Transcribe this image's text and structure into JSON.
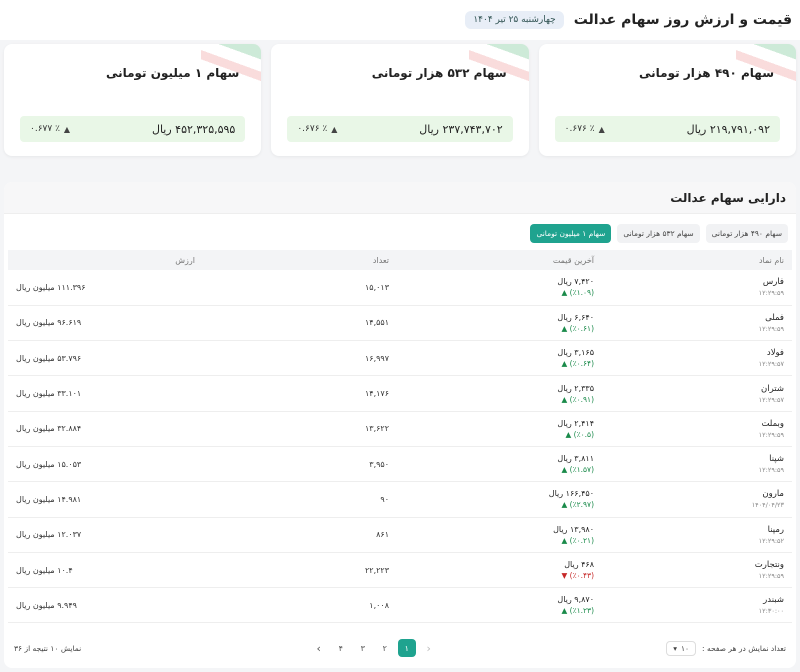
{
  "header": {
    "title": "قیمت و ارزش روز سهام عدالت",
    "date": "چهارشنبه ۲۵ تیر ۱۴۰۴"
  },
  "cards": [
    {
      "title": "سهام ۴۹۰ هزار تومانی",
      "price": "۲۱۹,۷۹۱,۰۹۲ ریال",
      "change": "٪ ۰.۶۷۶"
    },
    {
      "title": "سهام ۵۳۲ هزار تومانی",
      "price": "۲۳۷,۷۴۳,۷۰۲ ریال",
      "change": "٪ ۰.۶۷۶"
    },
    {
      "title": "سهام ۱ میلیون تومانی",
      "price": "۴۵۲,۳۲۵,۵۹۵ ریال",
      "change": "٪ ۰.۶۷۷"
    }
  ],
  "section": {
    "title": "دارایی سهام عدالت",
    "tabs": [
      "سهام ۴۹۰ هزار تومانی",
      "سهام ۵۳۲ هزار تومانی",
      "سهام ۱ میلیون تومانی"
    ],
    "active_tab": 2
  },
  "table": {
    "headers": [
      "نام نماد",
      "آخرین قیمت",
      "تعداد",
      "ارزش"
    ],
    "rows": [
      {
        "name": "فارس",
        "time": "۱۲:۲۹:۵۹",
        "price": "۷,۴۲۰ ریال",
        "change": "(٪۱.۰۹) ▲",
        "direction": "up",
        "count": "۱۵,۰۱۳",
        "value": "۱۱۱.۳۹۶ میلیون ریال"
      },
      {
        "name": "فملی",
        "time": "۱۲:۲۹:۵۹",
        "price": "۶,۶۴۰ ریال",
        "change": "(٪۰.۶۱) ▲",
        "direction": "up",
        "count": "۱۴,۵۵۱",
        "value": "۹۶.۶۱۹ میلیون ریال"
      },
      {
        "name": "فولاد",
        "time": "۱۲:۲۹:۵۷",
        "price": "۳,۱۶۵ ریال",
        "change": "(٪۰.۶۴) ▲",
        "direction": "up",
        "count": "۱۶,۹۹۷",
        "value": "۵۳.۷۹۶ میلیون ریال"
      },
      {
        "name": "شتران",
        "time": "۱۲:۲۹:۵۷",
        "price": "۲,۳۳۵ ریال",
        "change": "(٪۰.۹۱) ▲",
        "direction": "up",
        "count": "۱۴,۱۷۶",
        "value": "۳۳.۱۰۱ میلیون ریال"
      },
      {
        "name": "وبملت",
        "time": "۱۲:۲۹:۵۹",
        "price": "۲,۴۱۴ ریال",
        "change": "(٪۰.۵) ▲",
        "direction": "up",
        "count": "۱۳,۶۲۲",
        "value": "۳۲.۸۸۴ میلیون ریال"
      },
      {
        "name": "شپنا",
        "time": "۱۲:۲۹:۵۹",
        "price": "۳,۸۱۱ ریال",
        "change": "(٪۱.۵۷) ▲",
        "direction": "up",
        "count": "۳,۹۵۰",
        "value": "۱۵.۰۵۳ میلیون ریال"
      },
      {
        "name": "مارون",
        "time": "۱۴۰۴/۰۴/۲۳",
        "price": "۱۶۶,۴۵۰ ریال",
        "change": "(٪۲.۹۷) ▲",
        "direction": "up",
        "count": "۹۰",
        "value": "۱۴.۹۸۱ میلیون ریال"
      },
      {
        "name": "رمپنا",
        "time": "۱۲:۲۹:۵۲",
        "price": "۱۳,۹۸۰ ریال",
        "change": "(٪۰.۲۱) ▲",
        "direction": "up",
        "count": "۸۶۱",
        "value": "۱۲.۰۳۷ میلیون ریال"
      },
      {
        "name": "ونتجارت",
        "time": "۱۲:۲۹:۵۹",
        "price": "۴۶۸ ریال",
        "change": "(٪۰.۴۳) ▼",
        "direction": "down",
        "count": "۲۲,۲۲۳",
        "value": "۱۰.۴ میلیون ریال"
      },
      {
        "name": "شبندر",
        "time": "۱۲:۳۰:۰۰",
        "price": "۹,۸۷۰ ریال",
        "change": "(٪۱.۲۳) ▲",
        "direction": "up",
        "count": "۱,۰۰۸",
        "value": "۹.۹۴۹ میلیون ریال"
      }
    ]
  },
  "footer": {
    "per_page_label": "تعداد نمایش در هر صفحه :",
    "per_page_value": "۱۰",
    "results": "نمایش ۱۰ نتیجه از ۳۶",
    "pages": [
      "۱",
      "۲",
      "۳",
      "۴"
    ],
    "active_page": 0
  }
}
